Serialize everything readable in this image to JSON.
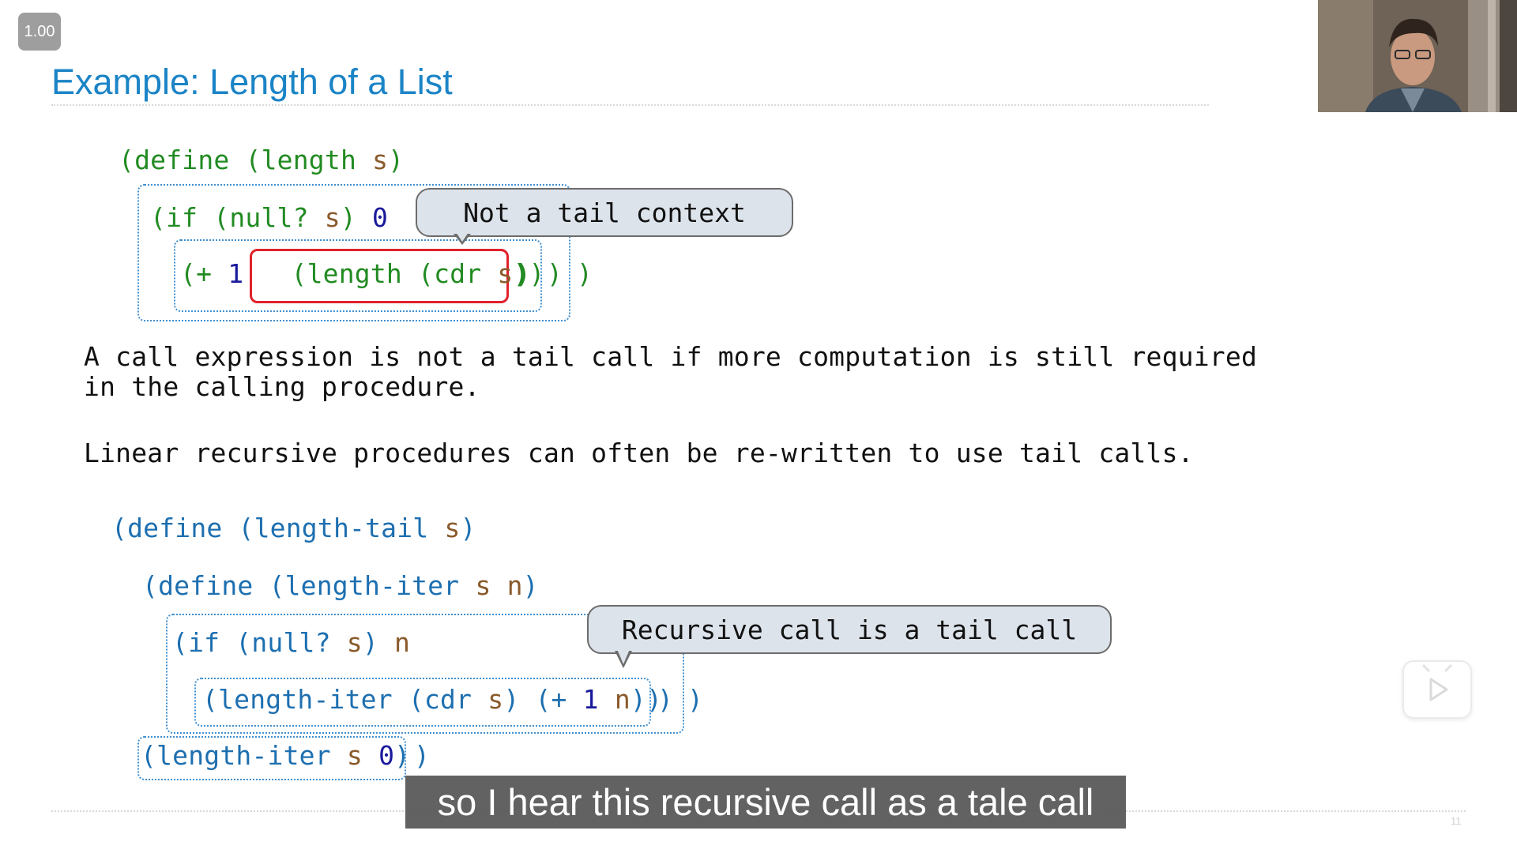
{
  "player": {
    "speed_label": "1.00"
  },
  "slide": {
    "title": "Example: Length of a List",
    "page_number": "11",
    "code1": {
      "line1": {
        "open": "(define (",
        "name": "length",
        "sp": " ",
        "arg": "s",
        "close": ")"
      },
      "line2": {
        "open": "(if (",
        "fn": "null?",
        "sp": " ",
        "arg": "s",
        "close": ") ",
        "zero": "0"
      },
      "line3": {
        "open": "(+ ",
        "one": "1",
        "sp": " "
      },
      "call": {
        "open": "(",
        "fn": "length",
        "mid": " (",
        "fn2": "cdr",
        "sp": " ",
        "arg": "s",
        "close": "))"
      },
      "tail": {
        "p1": ")",
        "p2": ")",
        "p3": ")"
      }
    },
    "bubble1": "Not a tail context",
    "para1_line1": "A call expression is not a tail call if more computation is still required",
    "para1_line2": "in the calling procedure.",
    "para2": "Linear recursive procedures can often be re-written to use tail calls.",
    "code2": {
      "line1": {
        "open": "(define (",
        "name": "length-tail",
        "sp": " ",
        "arg": "s",
        "close": ")"
      },
      "line2": {
        "open": "(define (",
        "name": "length-iter",
        "sp": " ",
        "arg1": "s",
        "sp2": " ",
        "arg2": "n",
        "close": ")"
      },
      "line3": {
        "open": "(if (",
        "fn": "null?",
        "sp": " ",
        "arg": "s",
        "close": ") ",
        "n": "n"
      },
      "line4": {
        "open": "(",
        "fn": "length-iter",
        "mid": " (",
        "fn2": "cdr",
        "sp": " ",
        "arg": "s",
        "mid2": ") (+ ",
        "one": "1",
        "sp2": " ",
        "n": "n",
        "close": "))"
      },
      "line4_tail": {
        "p1": ")",
        "p2": ")"
      },
      "line5": {
        "open": "(",
        "fn": "length-iter",
        "sp": " ",
        "arg": "s",
        "sp2": " ",
        "zero": "0",
        "close": ")"
      },
      "line5_tail": ")"
    },
    "bubble2": "Recursive call is a tail call"
  },
  "subtitle": "so I hear this recursive call as a tale call",
  "icons": {
    "play": "play-icon",
    "webcam": "webcam-feed"
  }
}
